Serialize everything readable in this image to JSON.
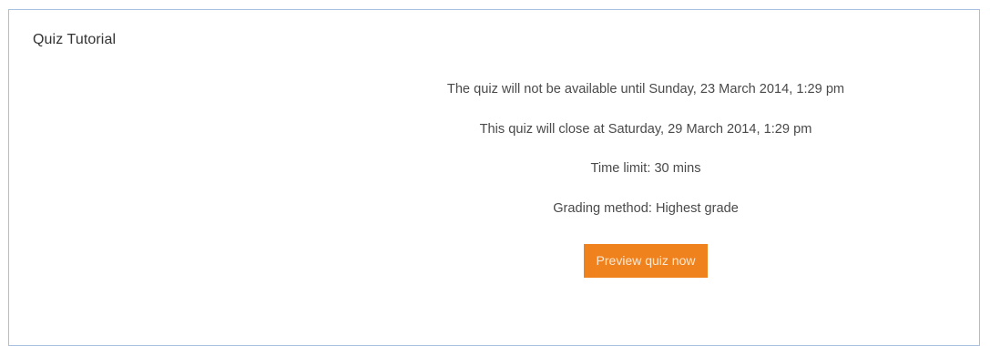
{
  "panel": {
    "title": "Quiz Tutorial"
  },
  "quiz_info": {
    "open_notice": "The quiz will not be available until Sunday, 23 March 2014, 1:29 pm",
    "close_notice": "This quiz will close at Saturday, 29 March 2014, 1:29 pm",
    "time_limit": "Time limit: 30 mins",
    "grading_method": "Grading method: Highest grade"
  },
  "actions": {
    "preview_label": "Preview quiz now"
  },
  "colors": {
    "button_bg": "#f0821e",
    "border": "#a7c0df"
  }
}
